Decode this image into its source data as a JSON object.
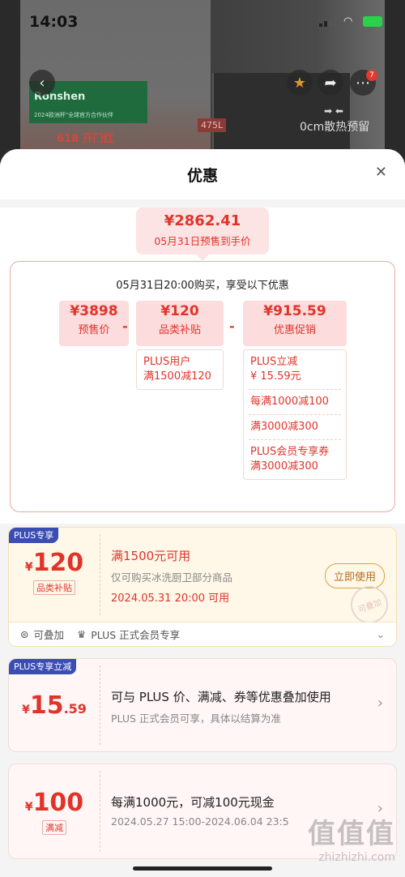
{
  "status": {
    "time": "14:03"
  },
  "background": {
    "brand_name": "Ronshen",
    "brand_tagline": "2024欧洲杯\"全球官方合作伙伴",
    "capacity_tag": "475L",
    "zero_gap_text": "0cm散热预留",
    "cart_badge": "7",
    "promo_618": "618 开门红"
  },
  "sheet": {
    "title": "优惠",
    "final_price": "¥2862.41",
    "final_price_note": "05月31日预售到手价",
    "calc_title": "05月31日20:00购买，享受以下优惠",
    "chips": [
      {
        "value": "¥3898",
        "label": "预售价"
      },
      {
        "value": "¥120",
        "label": "品类补贴"
      },
      {
        "value": "¥915.59",
        "label": "优惠促销"
      }
    ],
    "operators": [
      "-",
      "-"
    ],
    "subsidy_details": [
      "PLUS用户\n满1500减120"
    ],
    "promo_details": [
      "PLUS立减\n¥ 15.59元",
      "每满1000减100",
      "满3000减300",
      "PLUS会员专享券\n满3000减300"
    ]
  },
  "cards": [
    {
      "tag": "PLUS专享",
      "yuan": "¥",
      "amount": "120",
      "amount_dec": "",
      "label": "品类补贴",
      "main": "满1500元可用",
      "sub": "仅可购买冰洗厨卫部分商品",
      "date": "2024.05.31 20:00 可用",
      "button": "立即使用",
      "stamp": "可叠加",
      "foot_left": "可叠加",
      "foot_right": "PLUS 正式会员专享"
    },
    {
      "tag": "PLUS专享立减",
      "yuan": "¥",
      "amount": "15",
      "amount_dec": ".59",
      "main": "可与 PLUS 价、满减、券等优惠叠加使用",
      "sub": "PLUS 正式会员可享，具体以结算为准"
    },
    {
      "yuan": "¥",
      "amount": "100",
      "label": "满减",
      "main": "每满1000元，可减100元现金",
      "sub": "2024.05.27 15:00-2024.06.04 23:5"
    }
  ],
  "watermark": {
    "logo": "值值值",
    "site": "zhizhizhi.com"
  },
  "icons": [
    "back-icon",
    "star-icon",
    "share-icon",
    "more-icon",
    "close-icon",
    "chevron-down-icon",
    "chevron-right-icon",
    "stack-icon",
    "crown-icon"
  ],
  "colors": {
    "accent_red": "#e0342b",
    "plus_blue": "#3a4db3",
    "gold_bg": "#fff8e8"
  }
}
